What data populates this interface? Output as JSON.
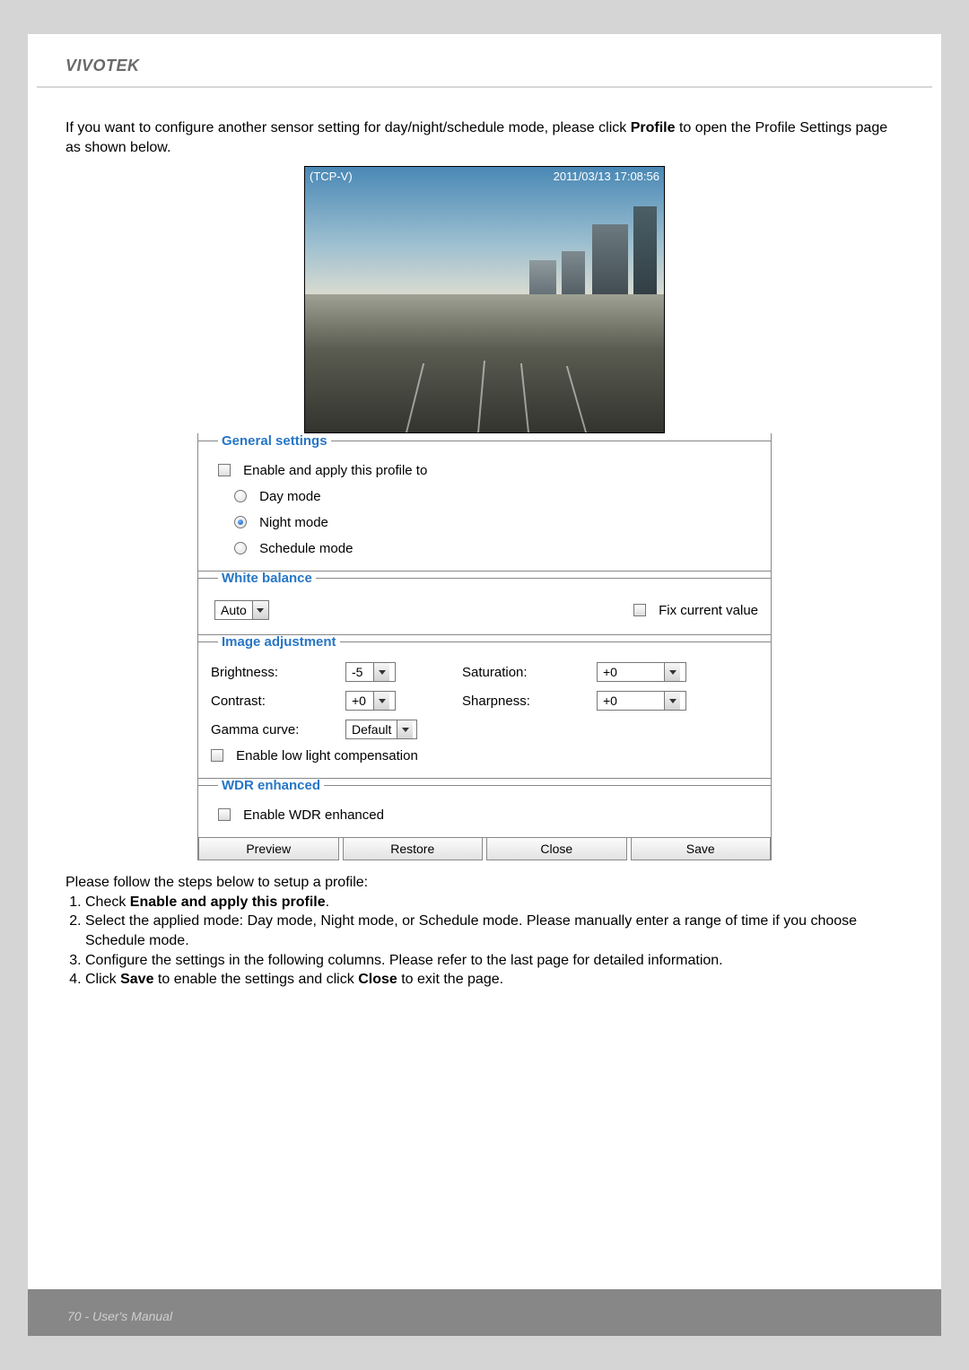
{
  "brand": "VIVOTEK",
  "intro": {
    "pre": "If you want to configure another sensor setting for day/night/schedule mode, please click ",
    "bold": "Profile",
    "post": " to open the Profile Settings page as shown below."
  },
  "preview": {
    "conn": "(TCP-V)",
    "timestamp": "2011/03/13  17:08:56"
  },
  "general": {
    "legend": "General settings",
    "enable_label": "Enable and apply this profile to",
    "day": "Day mode",
    "night": "Night mode",
    "schedule": "Schedule mode"
  },
  "wb": {
    "legend": "White balance",
    "mode": "Auto",
    "fix_label": "Fix current value"
  },
  "img": {
    "legend": "Image adjustment",
    "brightness_label": "Brightness:",
    "brightness": "-5",
    "saturation_label": "Saturation:",
    "saturation": "+0",
    "contrast_label": "Contrast:",
    "contrast": "+0",
    "sharpness_label": "Sharpness:",
    "sharpness": "+0",
    "gamma_label": "Gamma curve:",
    "gamma": "Default",
    "lowlight": "Enable low light compensation"
  },
  "wdr": {
    "legend": "WDR enhanced",
    "enable": "Enable WDR enhanced"
  },
  "buttons": {
    "preview": "Preview",
    "restore": "Restore",
    "close": "Close",
    "save": "Save"
  },
  "steps": {
    "intro": "Please follow the steps below to setup a profile:",
    "s1a": "Check ",
    "s1b": "Enable and apply this profile",
    "s1c": ".",
    "s2": "Select the applied mode: Day mode, Night mode, or Schedule mode. Please manually enter a range of time if you choose Schedule mode.",
    "s3": "Configure the settings in the following columns. Please refer to the last page for detailed information.",
    "s4a": "Click ",
    "s4b": "Save",
    "s4c": " to enable the settings and click ",
    "s4d": "Close",
    "s4e": " to exit the page."
  },
  "footer": {
    "page": "70",
    "sep": " - ",
    "title": "User's Manual"
  }
}
